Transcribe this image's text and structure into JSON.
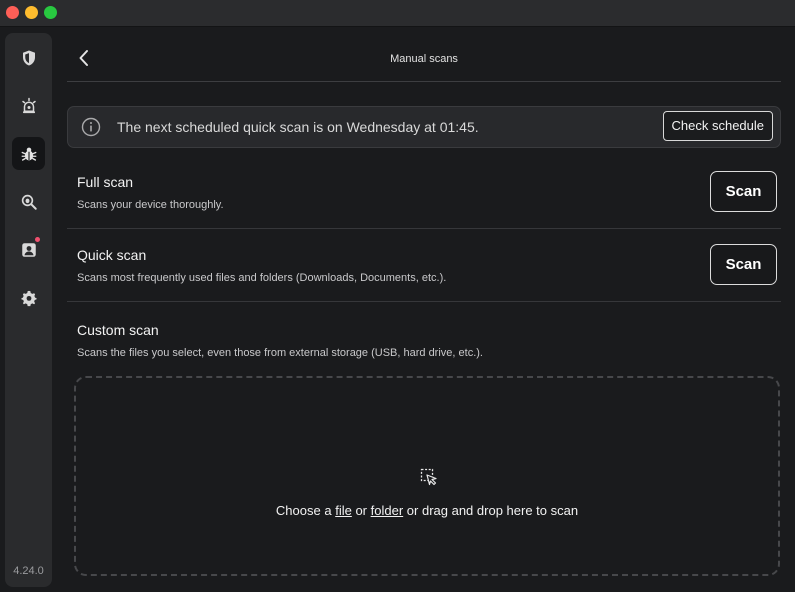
{
  "header": {
    "title": "Manual scans"
  },
  "sidebar": {
    "items": [
      {
        "icon": "shield-icon",
        "active": false
      },
      {
        "icon": "alarm-icon",
        "active": false
      },
      {
        "icon": "bug-icon",
        "active": true
      },
      {
        "icon": "search-bug-icon",
        "active": false
      },
      {
        "icon": "account-icon",
        "active": false,
        "notification": true
      },
      {
        "icon": "gear-icon",
        "active": false
      }
    ],
    "version": "4.24.0"
  },
  "banner": {
    "text": "The next scheduled quick scan is on Wednesday at 01:45.",
    "button": "Check schedule"
  },
  "scans": {
    "full": {
      "title": "Full scan",
      "desc": "Scans your device thoroughly.",
      "button": "Scan"
    },
    "quick": {
      "title": "Quick scan",
      "desc": "Scans most frequently used files and folders (Downloads, Documents, etc.).",
      "button": "Scan"
    },
    "custom": {
      "title": "Custom scan",
      "desc": "Scans the files you select, even those from external storage (USB, hard drive, etc.)."
    }
  },
  "dropzone": {
    "prefix": "Choose a",
    "file_link": "file",
    "or": "or",
    "folder_link": "folder",
    "suffix": "or drag and drop here to scan"
  },
  "colors": {
    "notification_dot": "#f0506e",
    "background": "#1a1b1d",
    "sidebar": "#2a2b2d"
  }
}
